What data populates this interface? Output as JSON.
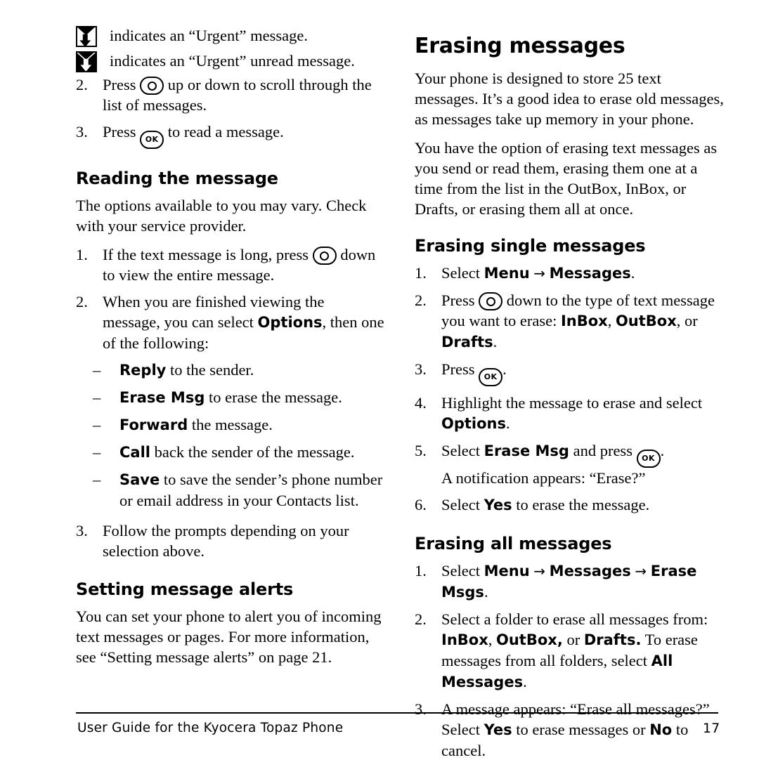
{
  "page": {
    "footer_text": "User Guide for the Kyocera Topaz Phone",
    "page_number": "17"
  },
  "left_column": {
    "icon_lines": [
      {
        "icon": "envelope-urgent-icon",
        "text": "indicates an “Urgent” message."
      },
      {
        "icon": "envelope-urgent-unread-icon",
        "text": "indicates an “Urgent” unread message."
      }
    ],
    "steps_top": [
      {
        "num": "2.",
        "pre": "Press",
        "key": "nav-key",
        "post": "up or down to scroll through the list of messages."
      },
      {
        "num": "3.",
        "pre": "Press",
        "key": "ok-key",
        "post": "to read a message."
      }
    ],
    "heading_reading": "Reading the message",
    "reading_intro": "The options available to you may vary. Check with your service provider.",
    "reading_steps": {
      "s1_num": "1.",
      "s1_pre": "If the text message is long, press",
      "s1_key": "nav-key",
      "s1_post": "down to view the entire message.",
      "s2_num": "2.",
      "s2_a": "When you are finished viewing the message, you can select ",
      "s2_bold": "Options",
      "s2_b": ", then one of the following:",
      "bullets": [
        {
          "bold": "Reply",
          "rest": " to the sender."
        },
        {
          "bold": "Erase Msg",
          "rest": " to erase the message."
        },
        {
          "bold": "Forward",
          "rest": " the message."
        },
        {
          "bold": "Call",
          "rest": " back the sender of the message."
        },
        {
          "bold": "Save",
          "rest": " to save the sender’s phone number or email address in your Contacts list."
        }
      ],
      "s3_num": "3.",
      "s3_text": "Follow the prompts depending on your selection above."
    },
    "heading_alerts": "Setting message alerts",
    "alerts_text": "You can set your phone to alert you of incoming text messages or pages. For more information, see “Setting message alerts” on page 21."
  },
  "right_column": {
    "heading_erasing": "Erasing messages",
    "para1": "Your phone is designed to store 25 text messages. It’s a good idea to erase old messages, as messages take up memory in your phone.",
    "para2": "You have the option of erasing text messages as you send or read them, erasing them one at a time from the list in the OutBox, InBox, or Drafts, or erasing them all at once.",
    "heading_single": "Erasing single messages",
    "single_steps": {
      "s1_num": "1.",
      "s1_pre": "Select ",
      "s1_b1": "Menu",
      "s1_arrow": "→",
      "s1_b2": "Messages",
      "s1_post": ".",
      "s2_num": "2.",
      "s2_pre": "Press",
      "s2_key": "nav-key",
      "s2_mid": "down to the type of text message you want to erase: ",
      "s2_b1": "InBox",
      "s2_sep1": ", ",
      "s2_b2": "OutBox",
      "s2_sep2": ", or ",
      "s2_b3": "Drafts",
      "s2_post": ".",
      "s3_num": "3.",
      "s3_pre": "Press",
      "s3_key": "ok-key",
      "s3_post": ".",
      "s4_num": "4.",
      "s4_pre": "Highlight the message to erase and select ",
      "s4_bold": "Options",
      "s4_post": ".",
      "s5_num": "5.",
      "s5_pre": "Select ",
      "s5_bold": "Erase Msg",
      "s5_mid": " and press",
      "s5_key": "ok-key",
      "s5_post": ".",
      "s5_line2": "A notification appears: “Erase?”",
      "s6_num": "6.",
      "s6_pre": "Select ",
      "s6_bold": "Yes",
      "s6_post": " to erase the message."
    },
    "heading_all": "Erasing all messages",
    "all_steps": {
      "s1_num": "1.",
      "s1_pre": "Select ",
      "s1_b1": "Menu",
      "s1_arrow1": "→",
      "s1_b2": "Messages",
      "s1_arrow2": "→",
      "s1_b3": "Erase Msgs",
      "s1_post": ".",
      "s2_num": "2.",
      "s2_pre": "Select a folder to erase all messages from: ",
      "s2_b1": "InBox",
      "s2_sep1": ", ",
      "s2_b2": "OutBox,",
      "s2_sep2": " or ",
      "s2_b3": "Drafts.",
      "s2_mid": " To erase messages from all folders, select ",
      "s2_b4": "All Messages",
      "s2_post": ".",
      "s3_num": "3.",
      "s3_line1": "A message appears: “Erase all messages?”",
      "s3_pre": "Select ",
      "s3_b1": "Yes",
      "s3_mid": " to erase messages or ",
      "s3_b2": "No",
      "s3_post": " to cancel."
    }
  }
}
